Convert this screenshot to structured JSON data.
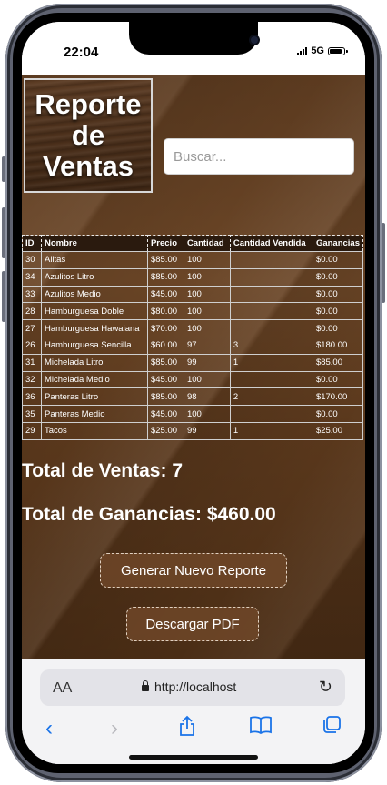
{
  "status_bar": {
    "time": "22:04",
    "network": "5G"
  },
  "header": {
    "logo_lines": [
      "Reporte",
      "de",
      "Ventas"
    ],
    "search_placeholder": "Buscar..."
  },
  "table": {
    "columns": [
      "ID",
      "Nombre",
      "Precio",
      "Cantidad",
      "Cantidad Vendida",
      "Ganancias"
    ],
    "rows": [
      [
        "30",
        "Alitas",
        "$85.00",
        "100",
        "",
        "$0.00"
      ],
      [
        "34",
        "Azulitos Litro",
        "$85.00",
        "100",
        "",
        "$0.00"
      ],
      [
        "33",
        "Azulitos Medio",
        "$45.00",
        "100",
        "",
        "$0.00"
      ],
      [
        "28",
        "Hamburguesa Doble",
        "$80.00",
        "100",
        "",
        "$0.00"
      ],
      [
        "27",
        "Hamburguesa Hawaiana",
        "$70.00",
        "100",
        "",
        "$0.00"
      ],
      [
        "26",
        "Hamburguesa Sencilla",
        "$60.00",
        "97",
        "3",
        "$180.00"
      ],
      [
        "31",
        "Michelada Litro",
        "$85.00",
        "99",
        "1",
        "$85.00"
      ],
      [
        "32",
        "Michelada Medio",
        "$45.00",
        "100",
        "",
        "$0.00"
      ],
      [
        "36",
        "Panteras Litro",
        "$85.00",
        "98",
        "2",
        "$170.00"
      ],
      [
        "35",
        "Panteras Medio",
        "$45.00",
        "100",
        "",
        "$0.00"
      ],
      [
        "29",
        "Tacos",
        "$25.00",
        "99",
        "1",
        "$25.00"
      ]
    ]
  },
  "totals": {
    "ventas": "Total de Ventas: 7",
    "ganancias": "Total de Ganancias: $460.00"
  },
  "buttons": {
    "generar": "Generar Nuevo Reporte",
    "descargar": "Descargar PDF"
  },
  "browser": {
    "aa_label": "AA",
    "url": "http://localhost"
  },
  "colors": {
    "background_brown": "#5b3a1f",
    "table_header_bg": "#2a1a0e",
    "safari_blue": "#1a73e8"
  },
  "icons": {
    "back": "chevron-left-icon",
    "forward": "chevron-right-icon",
    "share": "share-icon",
    "bookmarks": "book-icon",
    "tabs": "tabs-icon",
    "reload": "reload-icon",
    "lock": "lock-icon"
  }
}
